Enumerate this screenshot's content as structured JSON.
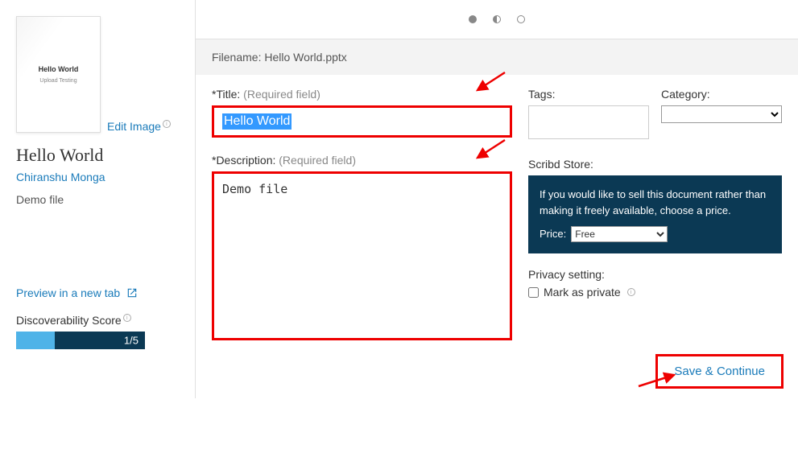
{
  "sidebar": {
    "thumb_title": "Hello World",
    "thumb_sub": "Upload Testing",
    "edit_image": "Edit Image",
    "doc_title": "Hello World",
    "author": "Chiranshu Monga",
    "doc_desc": "Demo file",
    "preview_link": "Preview in a new tab",
    "disc_label": "Discoverability Score",
    "disc_value": "1/5"
  },
  "filename": {
    "label": "Filename:",
    "value": "Hello World.pptx"
  },
  "form": {
    "title_label": "*Title:",
    "title_req": "(Required field)",
    "title_value": "Hello World",
    "desc_label": "*Description:",
    "desc_req": "(Required field)",
    "desc_value": "Demo file"
  },
  "right": {
    "tags_label": "Tags:",
    "cat_label": "Category:",
    "store_label": "Scribd Store:",
    "store_text": "If you would like to sell this document rather than making it freely available, choose a price.",
    "price_label": "Price:",
    "price_value": "Free",
    "privacy_label": "Privacy setting:",
    "mark_private": "Mark as private"
  },
  "save_btn": "Save & Continue"
}
